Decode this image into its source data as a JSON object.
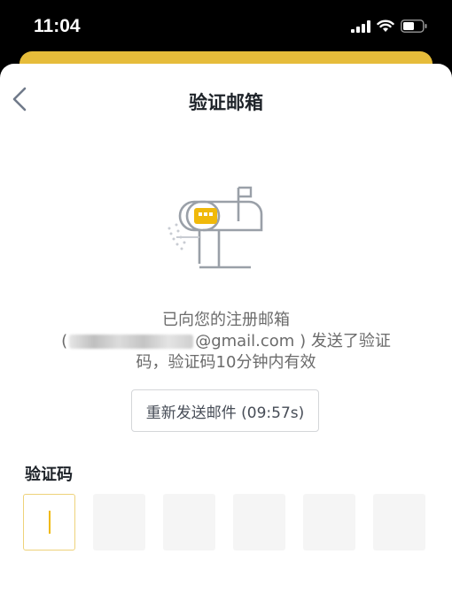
{
  "status_bar": {
    "time": "11:04",
    "icons": [
      "signal-icon",
      "wifi-icon",
      "battery-icon"
    ]
  },
  "header": {
    "back_icon": "chevron-left-icon",
    "title": "验证邮箱"
  },
  "illustration": {
    "icon": "mailbox-icon",
    "accent_color": "#F0B90B"
  },
  "message": {
    "line1": "已向您的注册邮箱",
    "email_suffix": "@gmail.com",
    "line2_after": " ) 发送了验证",
    "line3": "码，验证码10分钟内有效"
  },
  "resend_button": {
    "label": "重新发送邮件 (09:57s)"
  },
  "code_input": {
    "label": "验证码",
    "digit_count": 6,
    "active_index": 0
  },
  "colors": {
    "accent": "#F0B90B",
    "title_text": "#1E2329",
    "body_text": "#6B6B6B"
  }
}
